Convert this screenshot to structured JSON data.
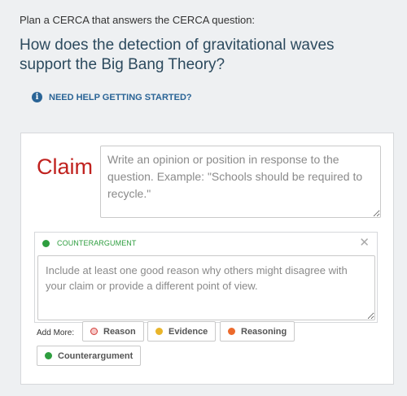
{
  "instruction": "Plan a CERCA that answers the CERCA question:",
  "question": "How does the detection of gravitational waves support the Big Bang Theory?",
  "help": {
    "label": "NEED HELP GETTING STARTED?",
    "icon": "info-icon"
  },
  "claim": {
    "label": "Claim",
    "placeholder": "Write an opinion or position in response to the question. Example: \"Schools should be required to recycle.\"",
    "value": "",
    "color": "#c0221f"
  },
  "counterargument": {
    "heading": "COUNTERARGUMENT",
    "color": "#2e9e3f",
    "close_icon": "close-icon",
    "placeholder": "Include at least one good reason why others might disagree with your claim or provide a different point of view.",
    "value": ""
  },
  "add_more": {
    "label": "Add More:",
    "buttons": [
      {
        "label": "Reason",
        "color": "#d23b36"
      },
      {
        "label": "Evidence",
        "color": "#e9b52a"
      },
      {
        "label": "Reasoning",
        "color": "#ec6a2c"
      },
      {
        "label": "Counterargument",
        "color": "#2e9e3f"
      }
    ]
  }
}
